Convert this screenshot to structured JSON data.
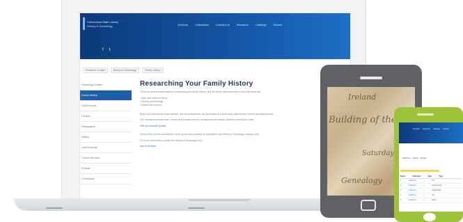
{
  "site": {
    "brand_line1": "Connecticut State Library",
    "brand_line2": "History & Genealogy",
    "nav": [
      "Services",
      "Collections",
      "Contact Us",
      "Research",
      "Catalogs",
      "Search"
    ],
    "social": [
      "f",
      "t"
    ]
  },
  "breadcrumb": [
    "Research Guides",
    "History & Genealogy",
    "Family History"
  ],
  "sidebar": [
    "Genealogy Guides",
    "Family History",
    "Vital Records",
    "Census",
    "Newspapers",
    "Military",
    "Land Records",
    "Church Records",
    "Probate",
    "Cemeteries"
  ],
  "main": {
    "title": "Researching Your Family History",
    "intro": "There are several basic steps in researching your family history, and the library has resources to help with each one.",
    "bullets": [
      "• Start with what you know",
      "• Record your findings",
      "• Search the records"
    ],
    "para1": "Begin with yourself and your parents, then work backward one generation at a time using vital records, census and land records.",
    "para2": "Our collections include town, church and probate records, newspapers and family histories covering the state.",
    "link1": "Visit our research guides",
    "para3": "Many of the records described in these guides are available on microfilm in the History & Genealogy reading room.",
    "para4": "For more information, contact the History & Genealogy Unit.",
    "link2": "Ask a Librarian"
  },
  "phone": {
    "nav": [
      "Services",
      "Research",
      "Catalogs",
      "Search"
    ],
    "tabs": [
      "Collections",
      "Search",
      "Browse"
    ],
    "table_head": [
      "Name",
      "Collection",
      "Date",
      "Type"
    ],
    "rows": [
      [
        "1",
        "Collection",
        "—",
        "NA"
      ],
      [
        "2",
        "Collection",
        "—",
        "Manuscripts"
      ],
      [
        "3",
        "Collection",
        "—",
        "Digital Files"
      ],
      [
        "4",
        "Collection",
        "—",
        "NA"
      ],
      [
        "5",
        "Collection",
        "—",
        "Maps"
      ]
    ]
  },
  "tablet": {
    "script_lines": [
      "Ireland",
      "Building of the house",
      "Saturday",
      "Genealogy"
    ]
  },
  "colors": {
    "header": "#1458a8",
    "sidebar_active": "#1f5ea8",
    "tablet": "#5f6164",
    "phone": "#9fc23b",
    "highlight": "#f2d64b"
  }
}
